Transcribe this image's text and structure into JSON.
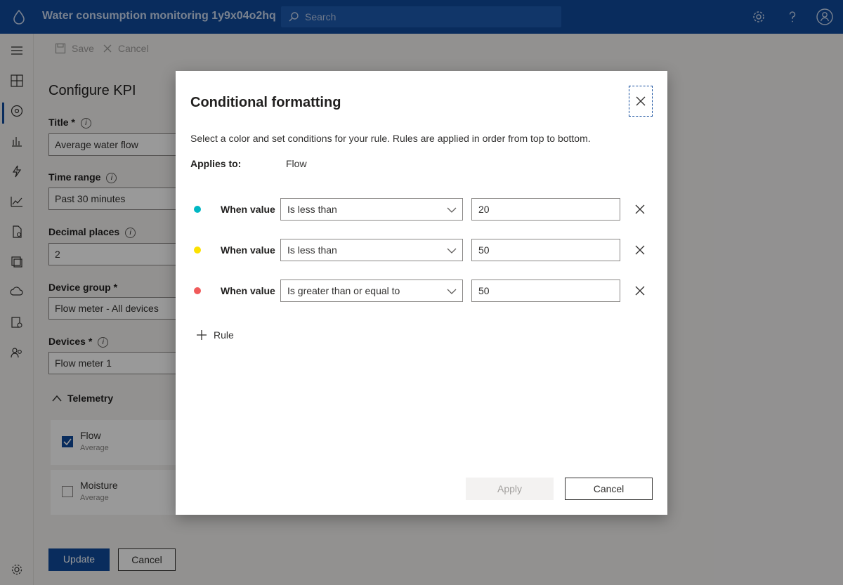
{
  "header": {
    "app_title": "Water consumption monitoring 1y9x04o2hq",
    "search_placeholder": "Search",
    "icons": [
      "water-drop-icon",
      "search-icon",
      "gear-icon",
      "help-icon",
      "account-icon"
    ]
  },
  "toolbar": {
    "save_label": "Save",
    "cancel_label": "Cancel"
  },
  "config_panel": {
    "title": "Configure KPI",
    "fields": {
      "title_label": "Title *",
      "title_value": "Average water flow",
      "time_range_label": "Time range",
      "time_range_value": "Past 30 minutes",
      "decimal_label": "Decimal places",
      "decimal_value": "2",
      "device_group_label": "Device group *",
      "device_group_value": "Flow meter - All devices",
      "devices_label": "Devices *",
      "devices_value": "Flow meter 1"
    },
    "telemetry_label": "Telemetry",
    "telemetry": [
      {
        "name": "Flow",
        "agg": "Average",
        "checked": true
      },
      {
        "name": "Moisture",
        "agg": "Average",
        "checked": false
      }
    ],
    "update_label": "Update",
    "cancel_label": "Cancel"
  },
  "dialog": {
    "title": "Conditional formatting",
    "description": "Select a color and set conditions for your rule. Rules are applied in order from top to bottom.",
    "applies_label": "Applies to:",
    "applies_value": "Flow",
    "when_label": "When value",
    "rules": [
      {
        "color": "#00b7c3",
        "condition": "Is less than",
        "value": "20"
      },
      {
        "color": "#fce100",
        "condition": "Is less than",
        "value": "50"
      },
      {
        "color": "#f05a5a",
        "condition": "Is greater than or equal to",
        "value": "50"
      }
    ],
    "add_rule_label": "Rule",
    "apply_label": "Apply",
    "cancel_label": "Cancel"
  }
}
